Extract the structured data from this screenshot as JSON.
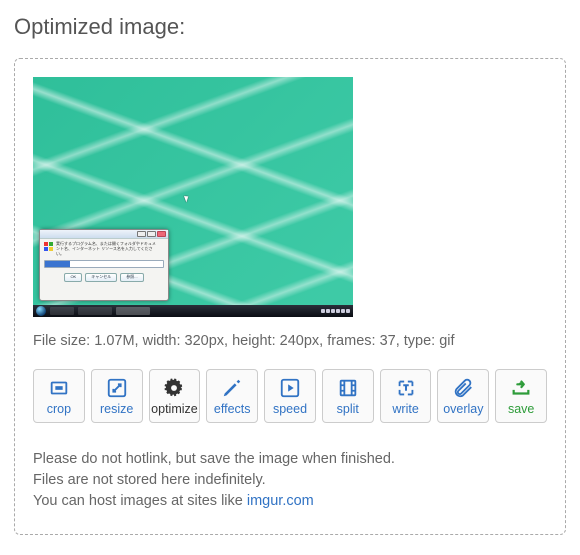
{
  "heading": "Optimized image:",
  "file_info": "File size: 1.07M, width: 320px, height: 240px, frames: 37, type: gif",
  "toolbar": {
    "crop": "crop",
    "resize": "resize",
    "optimize": "optimize",
    "effects": "effects",
    "speed": "speed",
    "split": "split",
    "write": "write",
    "overlay": "overlay",
    "save": "save"
  },
  "notes": {
    "line1": "Please do not hotlink, but save the image when finished.",
    "line2": "Files are not stored here indefinitely.",
    "line3_prefix": "You can host images at sites like ",
    "line3_link": "imgur.com"
  }
}
